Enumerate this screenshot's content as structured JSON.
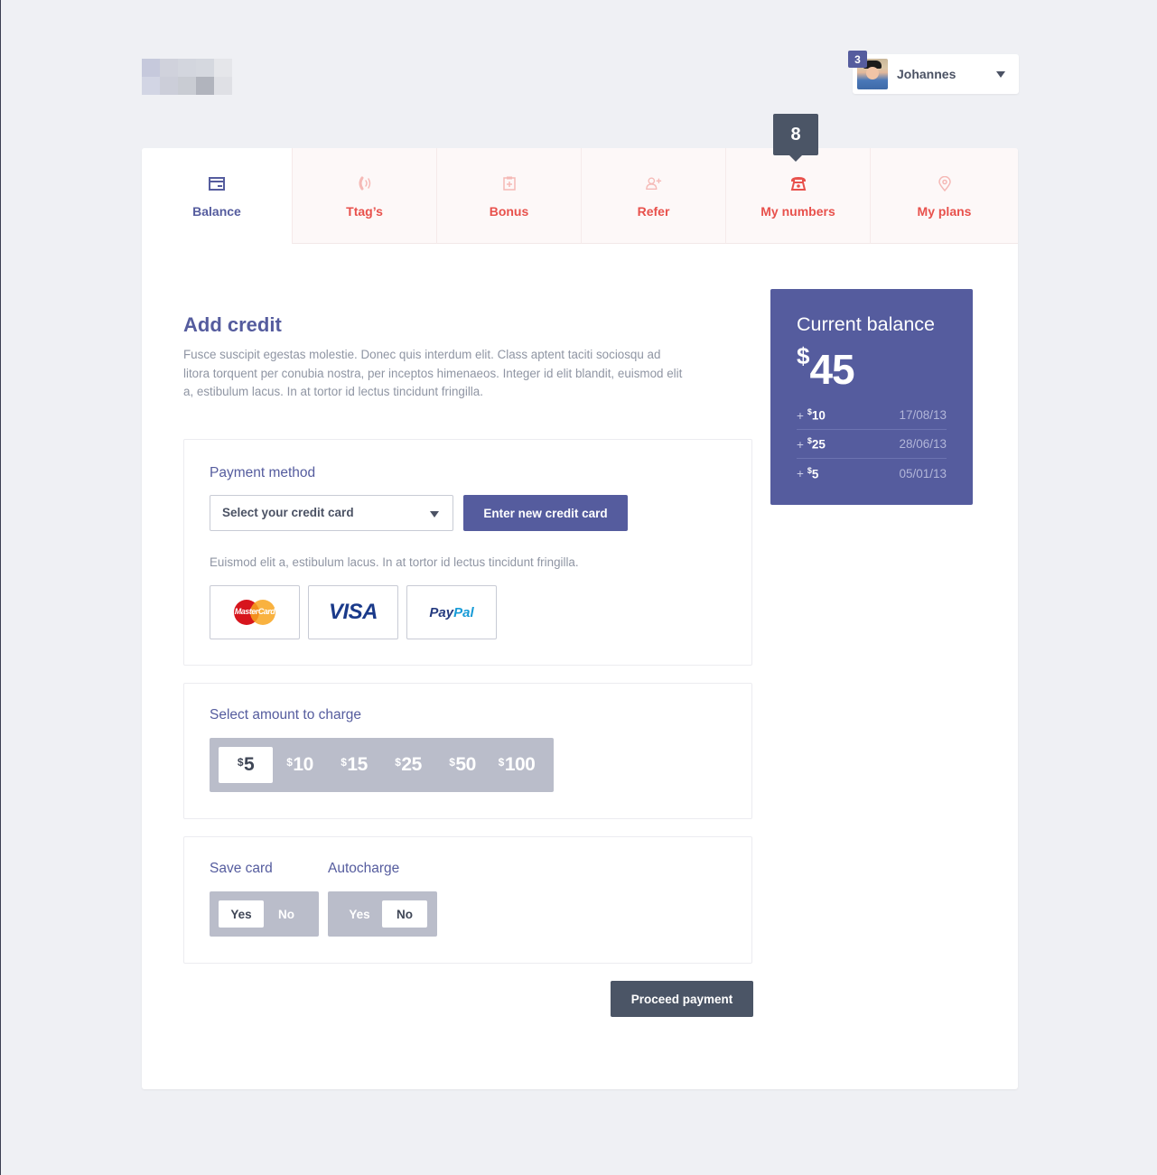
{
  "header": {
    "logo": {
      "name": "pixelated-logo",
      "pixels": [
        "#c6c9dc",
        "#d0d2dc",
        "#d3d6de",
        "#d5d8df",
        "#e5e6ea",
        "#d2d5e4",
        "#ccced9",
        "#c9ccd3",
        "#b1b4bd",
        "#dfe0e5"
      ]
    },
    "user": {
      "name": "Johannes",
      "notification_count": "3"
    }
  },
  "tabs": [
    {
      "label": "Balance",
      "icon": "credit-card-icon",
      "active": true
    },
    {
      "label": "Ttag’s",
      "icon": "signal-tag-icon",
      "active": false
    },
    {
      "label": "Bonus",
      "icon": "clipboard-plus-icon",
      "active": false
    },
    {
      "label": "Refer",
      "icon": "user-plus-icon",
      "active": false
    },
    {
      "label": "My numbers",
      "icon": "telephone-icon",
      "active": false,
      "badge": "8"
    },
    {
      "label": "My plans",
      "icon": "map-pin-icon",
      "active": false
    }
  ],
  "add_credit": {
    "title": "Add credit",
    "description": "Fusce suscipit egestas molestie. Donec quis interdum elit. Class aptent taciti sociosqu ad litora torquent per conubia nostra, per inceptos himenaeos. Integer id elit blandit, euismod elit a,  estibulum lacus. In at tortor id lectus tincidunt fringilla."
  },
  "payment_method": {
    "label": "Payment method",
    "select_placeholder": "Select your credit card",
    "new_card_button": "Enter new credit card",
    "note": "Euismod elit a,  estibulum lacus. In at tortor id lectus tincidunt fringilla.",
    "options": [
      {
        "name": "MasterCard",
        "text": "MasterCard"
      },
      {
        "name": "Visa",
        "text": "VISA"
      },
      {
        "name": "PayPal",
        "text_a": "Pay",
        "text_b": "Pal"
      }
    ]
  },
  "amount": {
    "label": "Select amount to charge",
    "currency": "$",
    "options": [
      "5",
      "10",
      "15",
      "25",
      "50",
      "100"
    ],
    "selected": "5"
  },
  "options": {
    "save_card": {
      "label": "Save card",
      "yes": "Yes",
      "no": "No",
      "value": "Yes"
    },
    "autocharge": {
      "label": "Autocharge",
      "yes": "Yes",
      "no": "No",
      "value": "No"
    }
  },
  "proceed_button": "Proceed payment",
  "balance": {
    "title": "Current balance",
    "currency": "$",
    "amount": "45",
    "history": [
      {
        "plus": "+",
        "amount": "10",
        "date": "17/08/13"
      },
      {
        "plus": "+",
        "amount": "25",
        "date": "28/06/13"
      },
      {
        "plus": "+",
        "amount": "5",
        "date": "05/01/13"
      }
    ]
  },
  "colors": {
    "accent": "#555c9e",
    "tab_inactive_text": "#e8514c",
    "dark_button": "#4b5566",
    "segment_bg": "#babdca",
    "page_bg": "#eff0f4"
  }
}
